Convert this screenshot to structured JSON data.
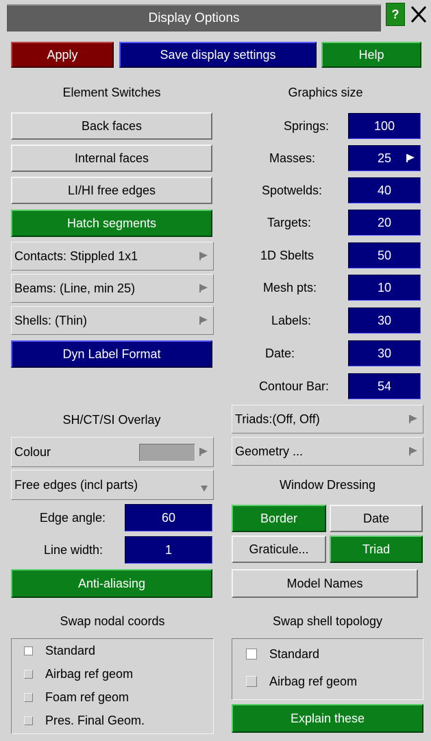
{
  "window": {
    "title": "Display Options",
    "help_glyph": "?",
    "close_icon": "close-icon"
  },
  "toolbar": {
    "apply": "Apply",
    "save": "Save display settings",
    "help": "Help"
  },
  "element_switches": {
    "heading": "Element Switches",
    "back_faces": "Back faces",
    "internal_faces": "Internal faces",
    "free_edges": "LI/HI free edges",
    "hatch_segments": "Hatch segments",
    "contacts": "Contacts: Stippled 1x1",
    "beams": "Beams: (Line, min 25)",
    "shells": "Shells: (Thin)",
    "dyn_label": "Dyn Label Format"
  },
  "graphics_size": {
    "heading": "Graphics size",
    "items": [
      {
        "label": "Springs:",
        "value": "100"
      },
      {
        "label": "Masses:",
        "value": "25"
      },
      {
        "label": "Spotwelds:",
        "value": "40"
      },
      {
        "label": "Targets:",
        "value": "20"
      },
      {
        "label": "1D Sbelts",
        "value": "50"
      },
      {
        "label": "Mesh pts:",
        "value": "10"
      },
      {
        "label": "Labels:",
        "value": "30"
      },
      {
        "label": "Date:",
        "value": "30"
      },
      {
        "label": "Contour Bar:",
        "value": "54"
      }
    ]
  },
  "overlay": {
    "heading": "SH/CT/SI Overlay",
    "colour_label": "Colour",
    "colour_value": "#a4a4a4",
    "free_edges_select": "Free edges (incl parts)",
    "edge_angle_label": "Edge angle:",
    "edge_angle_value": "60",
    "line_width_label": "Line width:",
    "line_width_value": "1",
    "anti_aliasing": "Anti-aliasing"
  },
  "right_menus": {
    "triads": "Triads:(Off, Off)",
    "geometry": "Geometry ..."
  },
  "window_dressing": {
    "heading": "Window Dressing",
    "border": "Border",
    "date": "Date",
    "graticule": "Graticule...",
    "triad": "Triad",
    "model_names": "Model Names"
  },
  "swap_nodal": {
    "heading": "Swap nodal coords",
    "options": [
      {
        "label": "Standard",
        "checked": true
      },
      {
        "label": "Airbag ref geom",
        "checked": false
      },
      {
        "label": "Foam ref geom",
        "checked": false
      },
      {
        "label": "Pres. Final Geom.",
        "checked": false
      }
    ]
  },
  "swap_shell": {
    "heading": "Swap shell topology",
    "options": [
      {
        "label": "Standard",
        "checked": true
      },
      {
        "label": "Airbag ref geom",
        "checked": false
      }
    ],
    "explain": "Explain these"
  },
  "colors": {
    "red": "#7f0000",
    "blue": "#00007f",
    "green": "#0b7f1a",
    "panel": "#d4d4d4"
  }
}
